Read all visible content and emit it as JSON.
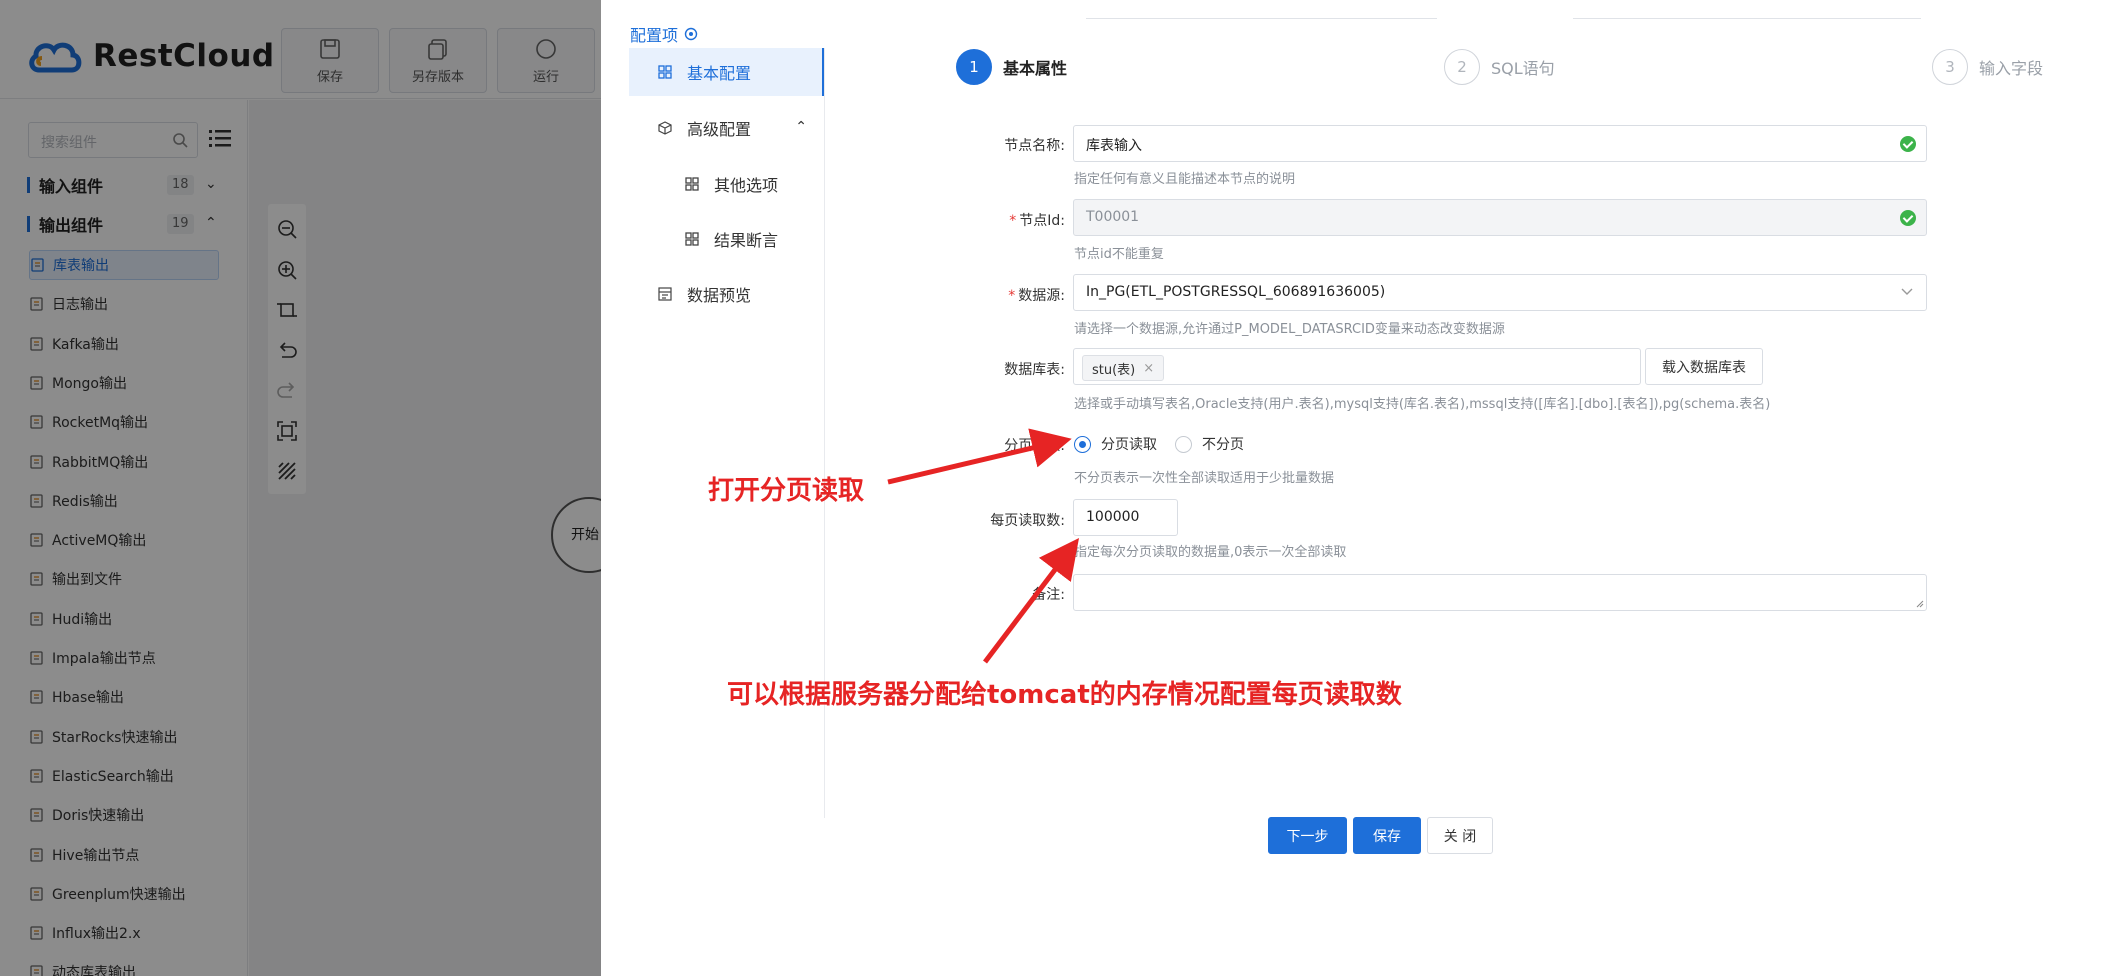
{
  "app": {
    "logo_text": "RestCloud",
    "toolbar": [
      {
        "label": "保存",
        "icon": "save-icon"
      },
      {
        "label": "另存版本",
        "icon": "copy-version-icon"
      },
      {
        "label": "运行",
        "icon": "run-icon"
      }
    ],
    "search_placeholder": "搜索组件",
    "groups": [
      {
        "name": "输入组件",
        "count": "18",
        "expanded": false
      },
      {
        "name": "输出组件",
        "count": "19",
        "expanded": true
      }
    ],
    "components": [
      "库表输出",
      "日志输出",
      "Kafka输出",
      "Mongo输出",
      "RocketMq输出",
      "RabbitMQ输出",
      "Redis输出",
      "ActiveMQ输出",
      "输出到文件",
      "Hudi输出",
      "Impala输出节点",
      "Hbase输出",
      "StarRocks快速输出",
      "ElasticSearch输出",
      "Doris快速输出",
      "Hive输出节点",
      "Greenplum快速输出",
      "Influx输出2.x",
      "动态库表输出"
    ],
    "start_node_label": "开始"
  },
  "drawer": {
    "config_title": "配置项",
    "menu": [
      {
        "label": "基本配置",
        "active": true
      },
      {
        "label": "高级配置",
        "active": false
      },
      {
        "label": "其他选项",
        "active": false
      },
      {
        "label": "结果断言",
        "active": false
      },
      {
        "label": "数据预览",
        "active": false
      }
    ],
    "steps": [
      {
        "num": "1",
        "title": "基本属性",
        "active": true
      },
      {
        "num": "2",
        "title": "SQL语句",
        "active": false
      },
      {
        "num": "3",
        "title": "输入字段",
        "active": false
      }
    ],
    "form": {
      "node_name": {
        "label": "节点名称:",
        "value": "库表输入",
        "help": "指定任何有意义且能描述本节点的说明"
      },
      "node_id": {
        "label": "节点Id:",
        "value": "T00001",
        "help": "节点id不能重复"
      },
      "datasource": {
        "label": "数据源:",
        "value": "In_PG(ETL_POSTGRESSQL_606891636005)",
        "help": "请选择一个数据源,允许通过P_MODEL_DATASRCID变量来动态改变数据源"
      },
      "table": {
        "label": "数据库表:",
        "tag": "stu(表)",
        "load_button": "载入数据库表",
        "help": "选择或手动填写表名,Oracle支持(用户.表名),mysql支持(库名.表名),mssql支持([库名].[dbo].[表名]),pg(schema.表名)"
      },
      "paging": {
        "label": "分页读取:",
        "options": [
          "分页读取",
          "不分页"
        ],
        "selected": "分页读取",
        "help": "不分页表示一次性全部读取适用于少批量数据"
      },
      "page_size": {
        "label": "每页读取数:",
        "value": "100000",
        "help": "指定每次分页读取的数据量,0表示一次全部读取"
      },
      "remark": {
        "label": "备注:",
        "value": ""
      }
    },
    "buttons": {
      "next": "下一步",
      "save": "保存",
      "close": "关 闭"
    }
  },
  "annotations": {
    "open_paging": "打开分页读取",
    "memory_tip": "可以根据服务器分配给tomcat的内存情况配置每页读取数"
  },
  "colors": {
    "primary": "#1e6fd9",
    "annotation": "#e62424",
    "success": "#3cb34a"
  }
}
